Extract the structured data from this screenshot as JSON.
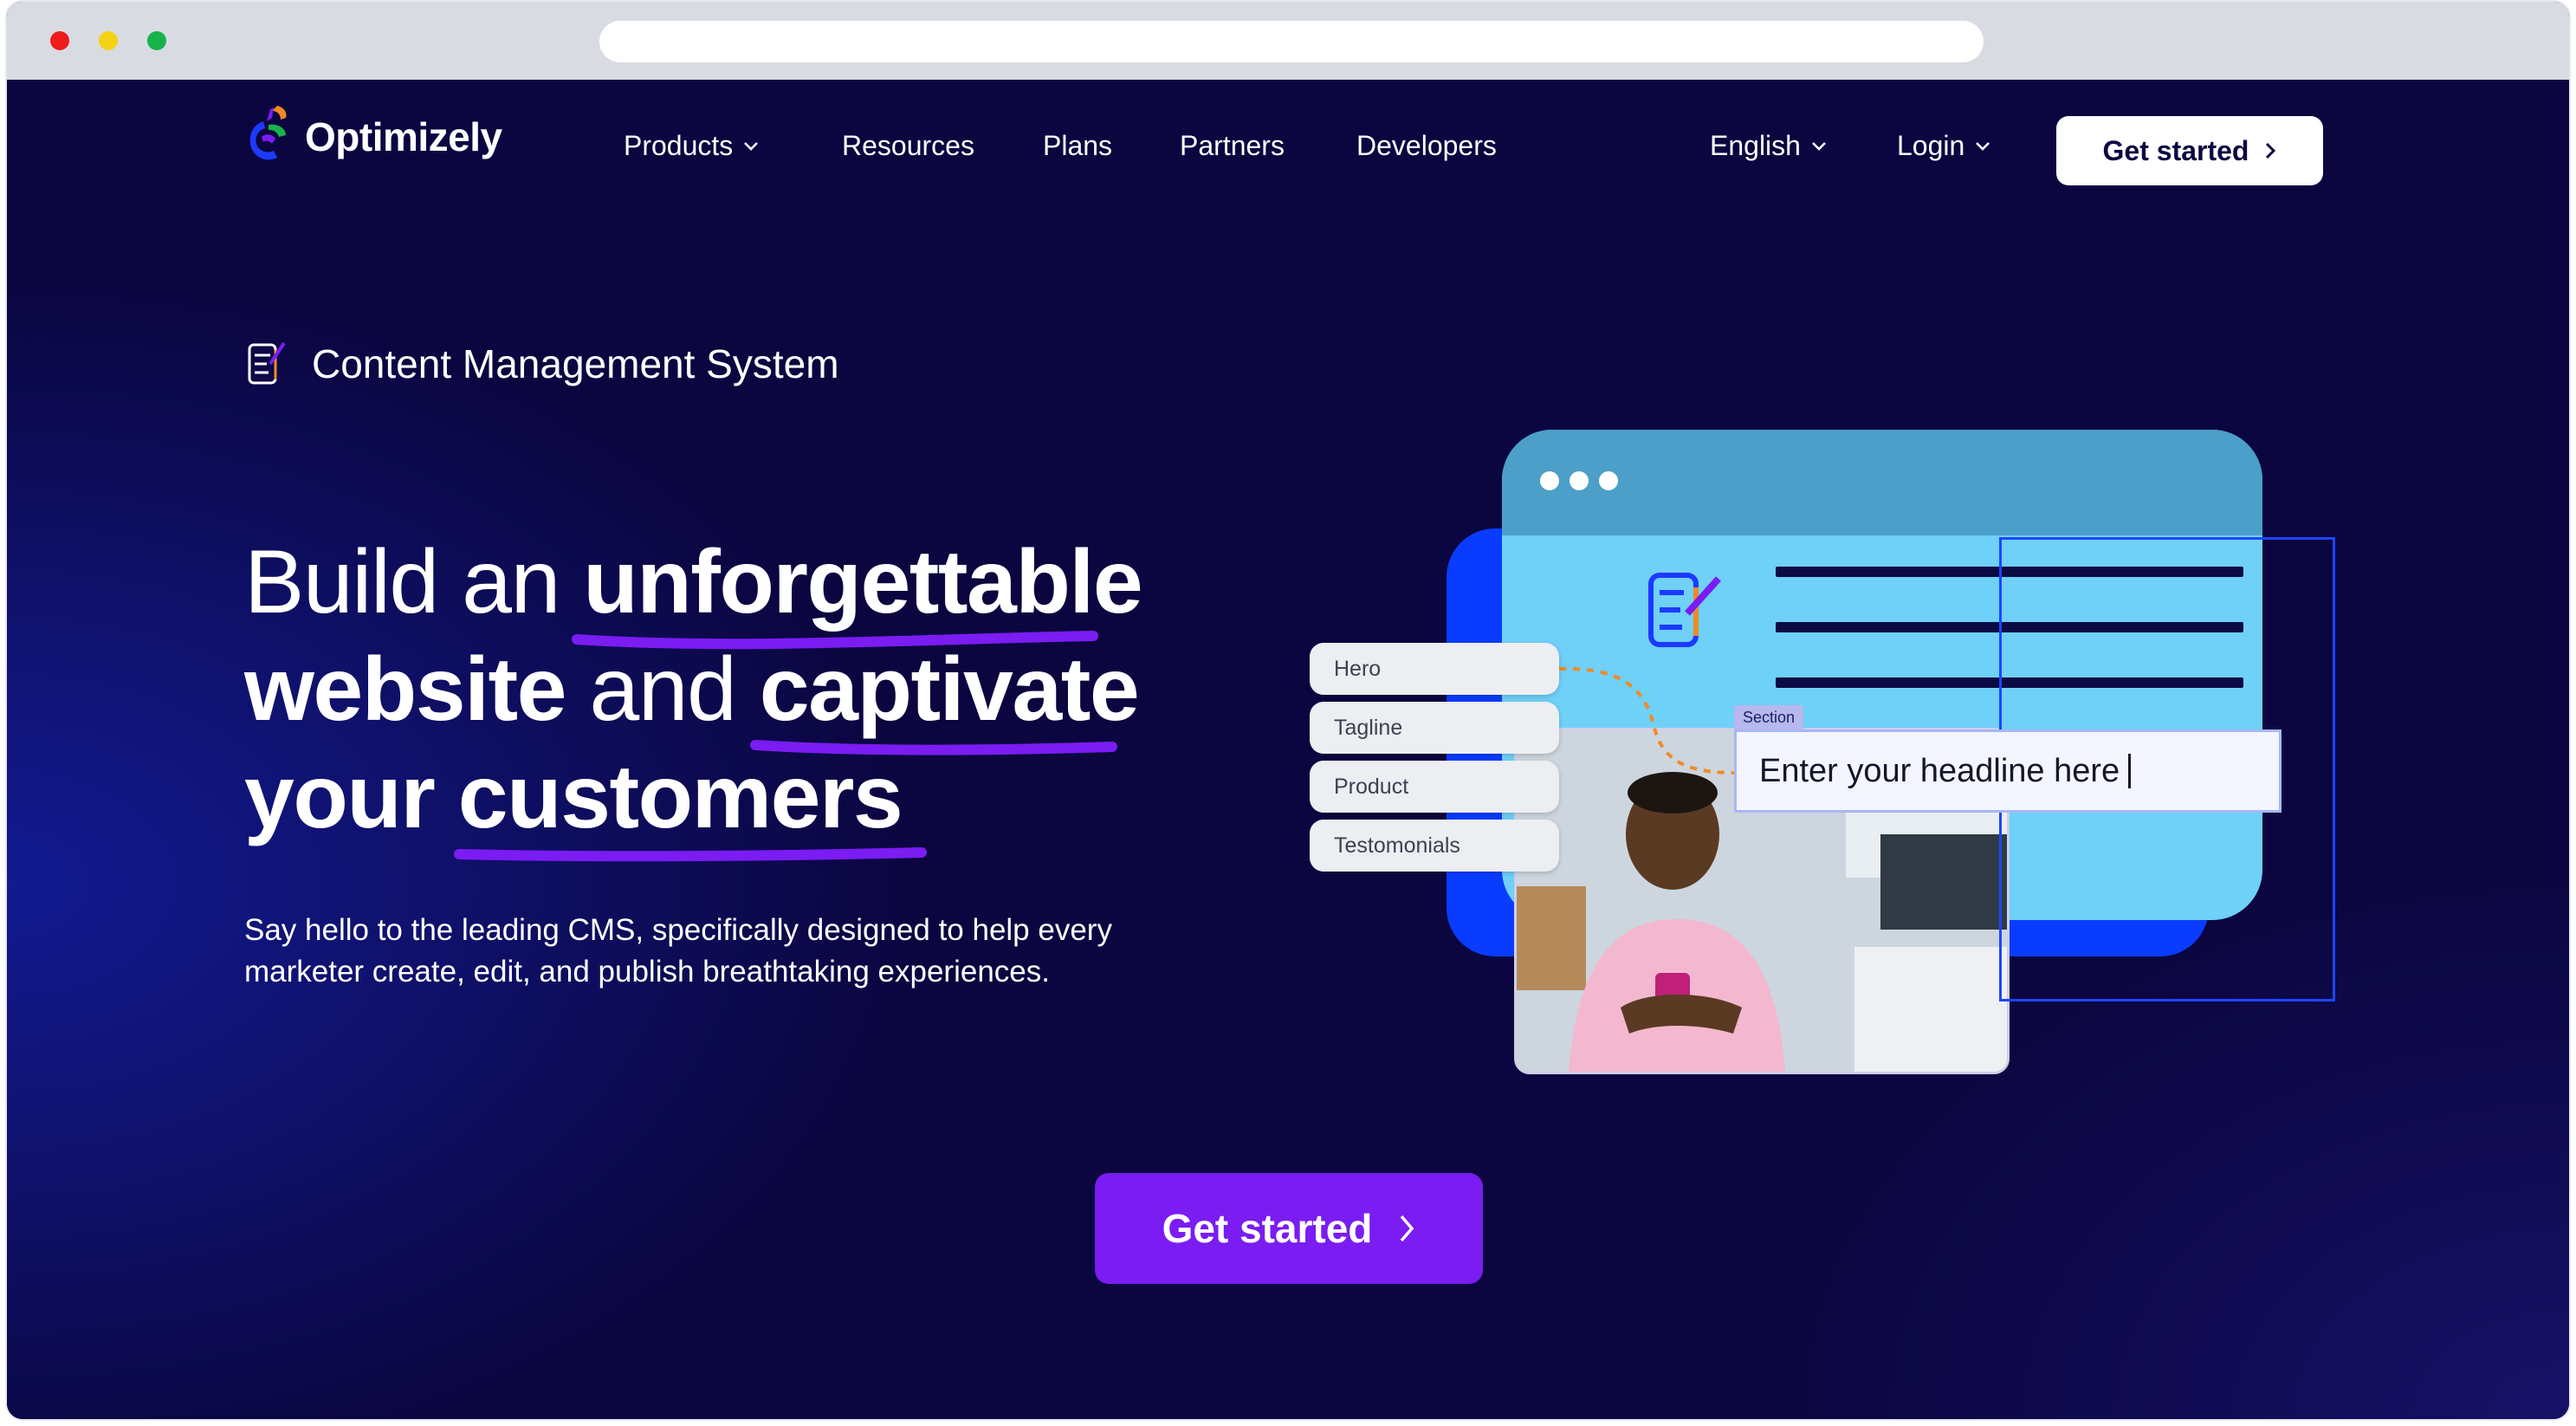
{
  "window": {
    "traffic_lights": [
      "red",
      "yellow",
      "green"
    ],
    "colors": {
      "red": "#ee1c1c",
      "yellow": "#f5d214",
      "green": "#16b34a"
    }
  },
  "brand": {
    "name": "Optimizely",
    "logo_icon": "optimizely-logo-icon"
  },
  "nav": {
    "items": [
      {
        "label": "Products",
        "has_dropdown": true
      },
      {
        "label": "Resources",
        "has_dropdown": false
      },
      {
        "label": "Plans",
        "has_dropdown": false
      },
      {
        "label": "Partners",
        "has_dropdown": false
      },
      {
        "label": "Developers",
        "has_dropdown": false
      }
    ],
    "language": "English",
    "login": "Login",
    "cta": "Get started"
  },
  "hero": {
    "kicker_icon": "cms-document-edit-icon",
    "kicker": "Content Management System",
    "headline": {
      "line1_a": "Build an ",
      "line1_b": "unforgettable",
      "line2_a": "website",
      "line2_b": " and ",
      "line2_c": "captivate",
      "line3_a": "your ",
      "line3_b": "customers"
    },
    "subtext_line1": "Say hello to the leading CMS, specifically designed to help every",
    "subtext_line2": "marketer create, edit, and publish breathtaking experiences.",
    "cta": "Get started"
  },
  "illustration": {
    "tags": [
      "Hero",
      "Tagline",
      "Product",
      "Testomonials"
    ],
    "section_label": "Section",
    "headline_placeholder": "Enter your headline here",
    "colors": {
      "background": "#0b0640",
      "browser_body": "#6fd0f8",
      "browser_top": "#4b9fc8",
      "back_card": "#0a3cff",
      "accent_purple": "#7a1cf2",
      "dashed_orange": "#f08a24"
    }
  }
}
